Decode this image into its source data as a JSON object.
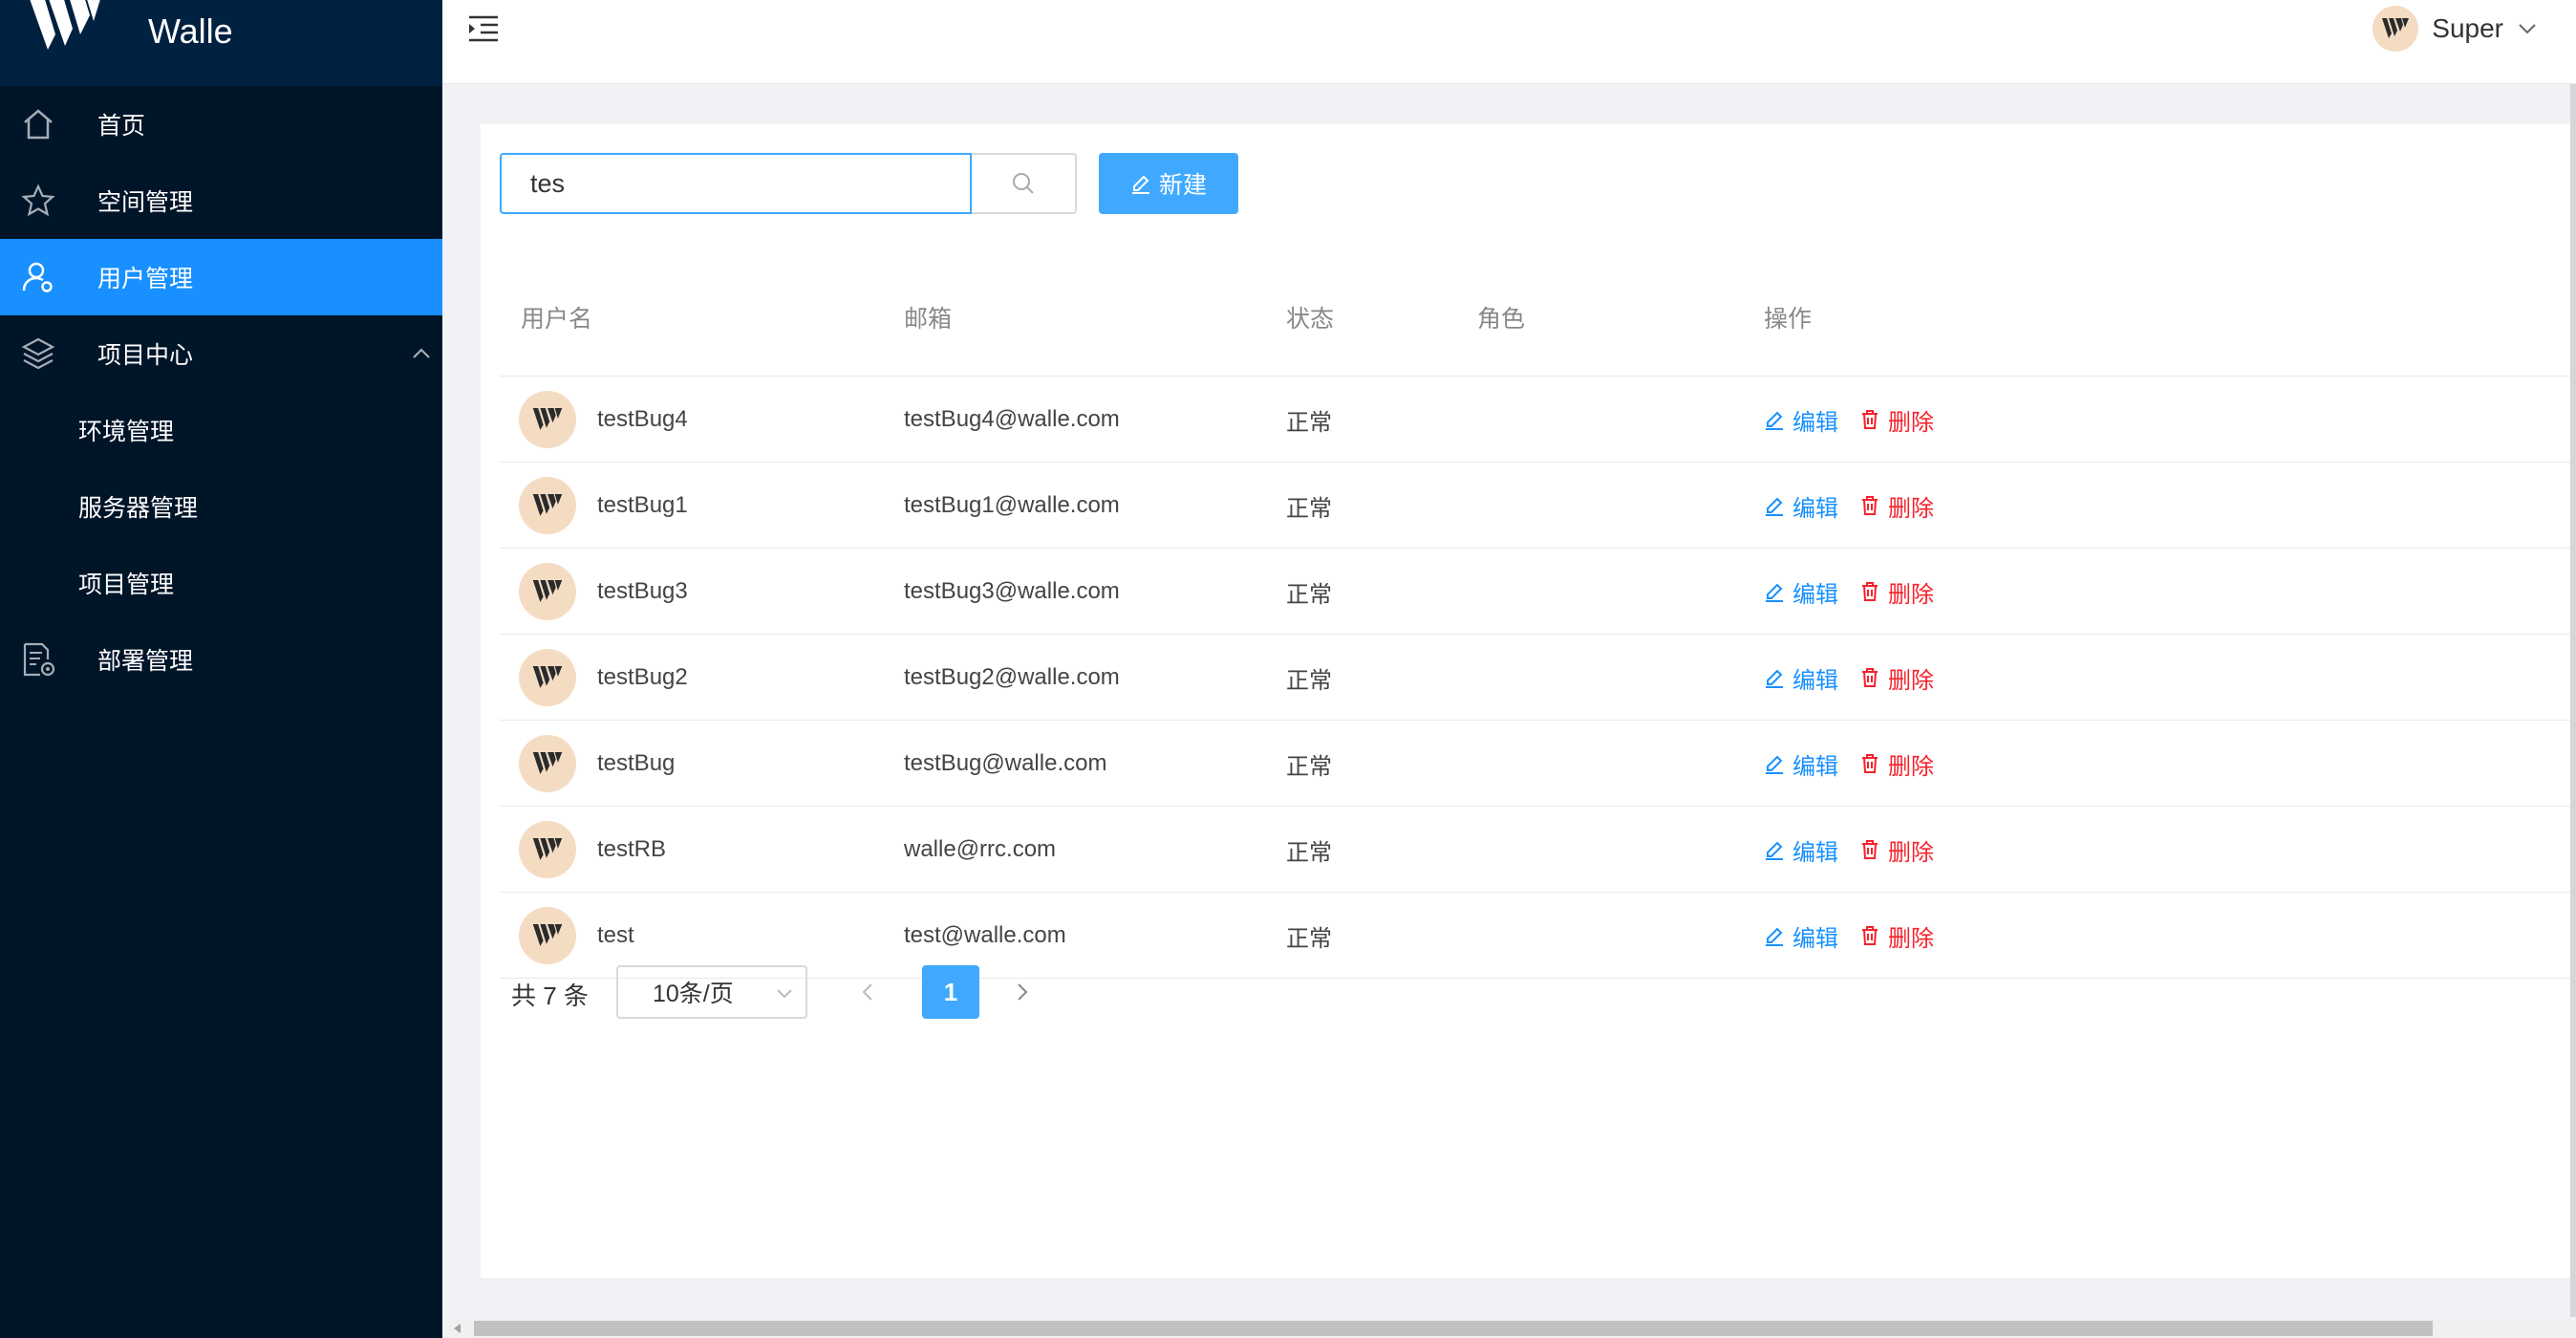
{
  "app": {
    "title": "Walle"
  },
  "sidebar": {
    "items": [
      {
        "label": "首页",
        "icon": "home-icon"
      },
      {
        "label": "空间管理",
        "icon": "star-icon"
      },
      {
        "label": "用户管理",
        "icon": "user-icon",
        "active": true
      },
      {
        "label": "项目中心",
        "icon": "layers-icon",
        "expanded": true
      },
      {
        "label": "部署管理",
        "icon": "deploy-icon"
      }
    ],
    "sub_items": [
      {
        "label": "环境管理"
      },
      {
        "label": "服务器管理"
      },
      {
        "label": "项目管理"
      }
    ]
  },
  "header": {
    "user_name": "Super"
  },
  "search": {
    "value": "tes",
    "placeholder": ""
  },
  "toolbar": {
    "new_label": "新建"
  },
  "table": {
    "columns": [
      "用户名",
      "邮箱",
      "状态",
      "角色",
      "操作"
    ],
    "rows": [
      {
        "username": "testBug4",
        "email": "testBug4@walle.com",
        "status": "正常",
        "role": ""
      },
      {
        "username": "testBug1",
        "email": "testBug1@walle.com",
        "status": "正常",
        "role": ""
      },
      {
        "username": "testBug3",
        "email": "testBug3@walle.com",
        "status": "正常",
        "role": ""
      },
      {
        "username": "testBug2",
        "email": "testBug2@walle.com",
        "status": "正常",
        "role": ""
      },
      {
        "username": "testBug",
        "email": "testBug@walle.com",
        "status": "正常",
        "role": ""
      },
      {
        "username": "testRB",
        "email": "walle@rrc.com",
        "status": "正常",
        "role": ""
      },
      {
        "username": "test",
        "email": "test@walle.com",
        "status": "正常",
        "role": ""
      }
    ],
    "edit_label": "编辑",
    "delete_label": "删除"
  },
  "pagination": {
    "total_text": "共 7 条",
    "page_size": "10条/页",
    "current_page": "1"
  },
  "colors": {
    "sidebar_bg": "#011529",
    "active": "#1890ff",
    "danger": "#f5222d",
    "avatar_bg": "#f4dcc3"
  }
}
